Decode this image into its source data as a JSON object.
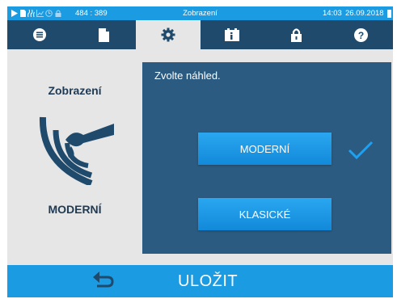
{
  "status_bar": {
    "coords": "484 : 389",
    "title": "Zobrazení",
    "time": "14:03",
    "date": "26.09.2018",
    "icons": [
      "play-icon",
      "document-icon",
      "steam-icon",
      "graph-icon",
      "clock-icon",
      "lock-icon",
      "battery-icon"
    ]
  },
  "tabs": [
    {
      "icon": "menu-icon",
      "active": false
    },
    {
      "icon": "document-icon",
      "active": false
    },
    {
      "icon": "gear-icon",
      "active": true
    },
    {
      "icon": "info-card-icon",
      "active": false
    },
    {
      "icon": "lock-icon",
      "active": false
    },
    {
      "icon": "help-icon",
      "active": false
    }
  ],
  "left": {
    "title": "Zobrazení",
    "current_mode": "MODERNÍ",
    "icon": "display-view-icon"
  },
  "panel": {
    "prompt": "Zvolte náhled.",
    "options": [
      {
        "label": "MODERNÍ",
        "selected": true
      },
      {
        "label": "KLASICKÉ",
        "selected": false
      }
    ]
  },
  "footer": {
    "back_icon": "back-arrow-icon",
    "save_label": "ULOŽIT"
  },
  "colors": {
    "accent": "#1b9be2",
    "tab_bar": "#1f4a6c",
    "panel": "#2b5b80",
    "check": "#1da1f2",
    "text_dark": "#1f3a54"
  }
}
